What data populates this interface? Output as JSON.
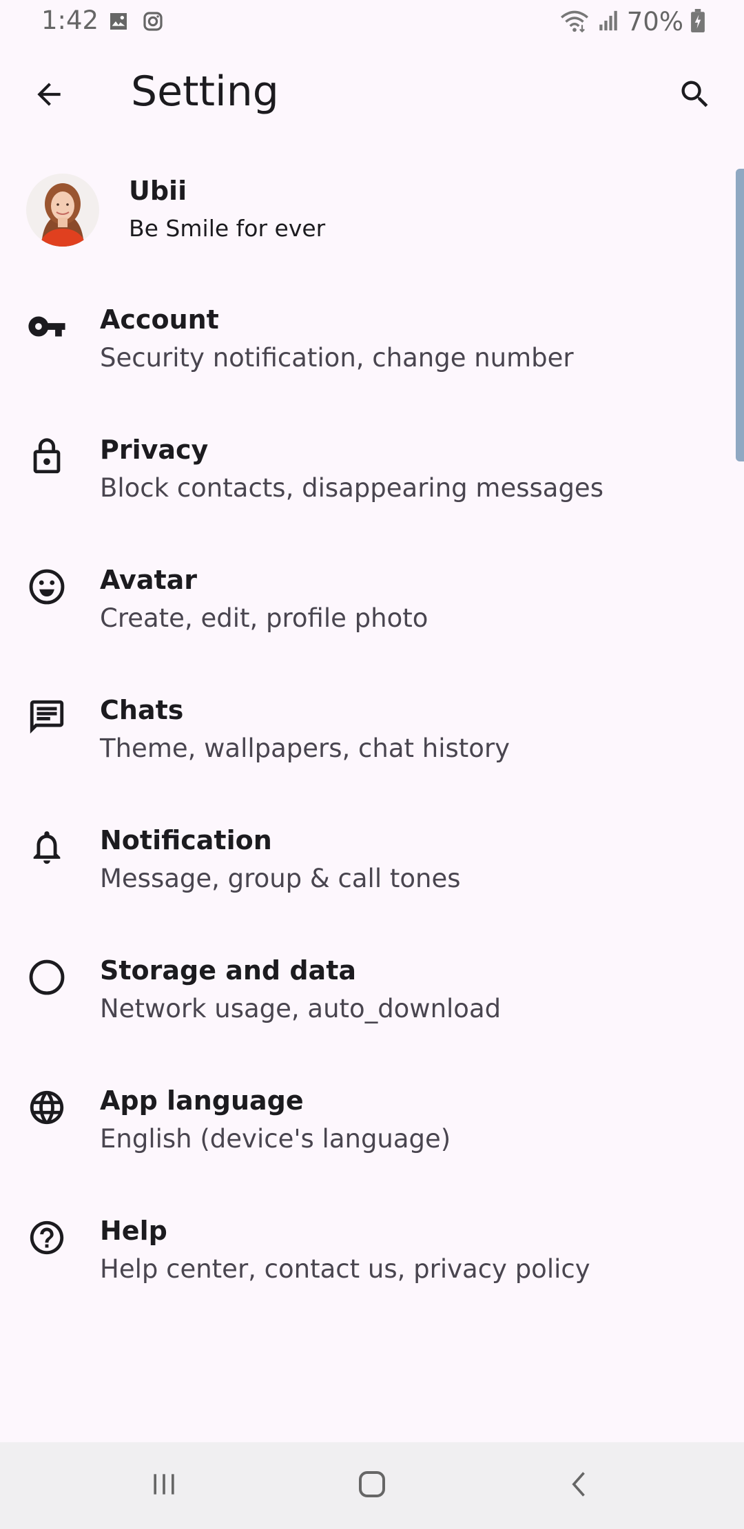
{
  "status_bar": {
    "time": "1:42",
    "battery": "70%",
    "icons": [
      "gallery-icon",
      "instagram-icon",
      "wifi-icon",
      "signal-icon",
      "battery-charging-icon"
    ]
  },
  "app_bar": {
    "title": "Setting",
    "back_icon": "arrow-back-icon",
    "search_icon": "search-icon"
  },
  "profile": {
    "name": "Ubii",
    "status": "Be Smile for ever"
  },
  "settings": [
    {
      "icon": "key-icon",
      "title": "Account",
      "subtitle": "Security notification, change number"
    },
    {
      "icon": "lock-icon",
      "title": "Privacy",
      "subtitle": "Block contacts, disappearing messages"
    },
    {
      "icon": "smiley-icon",
      "title": "Avatar",
      "subtitle": "Create, edit, profile photo"
    },
    {
      "icon": "chat-icon",
      "title": "Chats",
      "subtitle": "Theme, wallpapers, chat history"
    },
    {
      "icon": "bell-icon",
      "title": "Notification",
      "subtitle": "Message, group & call tones"
    },
    {
      "icon": "circle-icon",
      "title": "Storage and data",
      "subtitle": "Network usage, auto_download"
    },
    {
      "icon": "globe-icon",
      "title": "App language",
      "subtitle": "English (device's language)"
    },
    {
      "icon": "help-icon",
      "title": "Help",
      "subtitle": "Help center, contact us, privacy policy"
    }
  ],
  "nav_bar": {
    "icons": [
      "recents-icon",
      "home-icon",
      "back-icon"
    ]
  }
}
